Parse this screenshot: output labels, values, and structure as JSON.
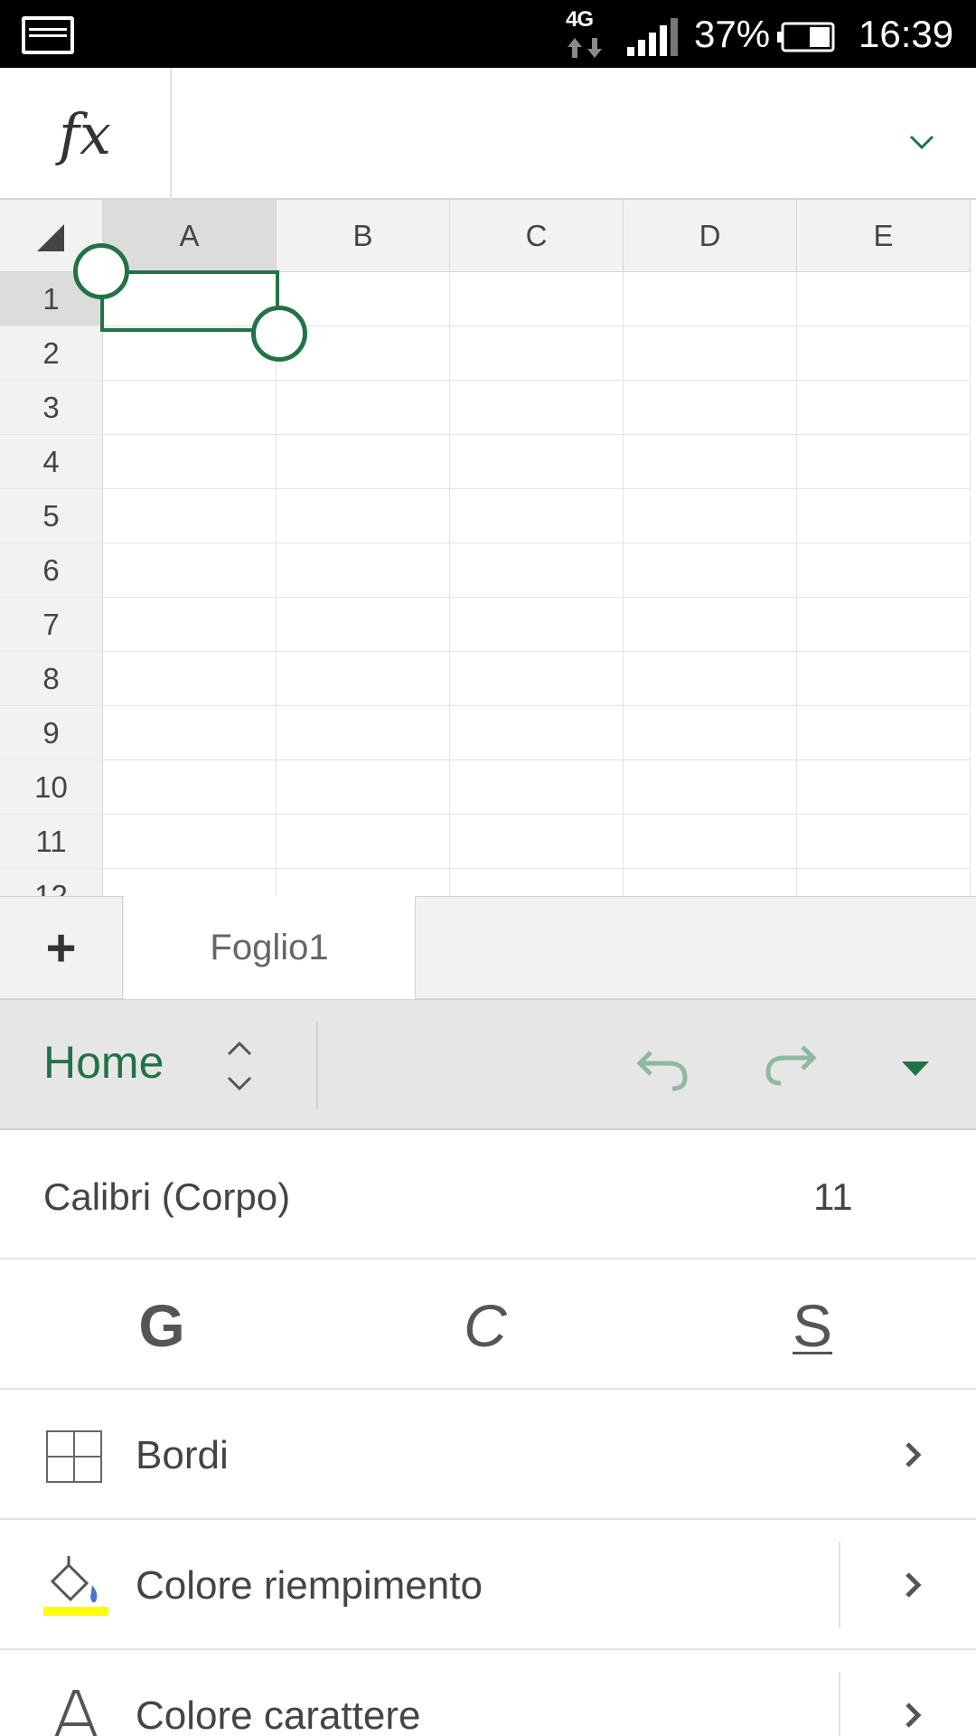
{
  "status_bar": {
    "network": "4G",
    "battery_percent": "37%",
    "time": "16:39"
  },
  "formula_bar": {
    "fx_label": "fx",
    "value": ""
  },
  "grid": {
    "columns": [
      "A",
      "B",
      "C",
      "D",
      "E"
    ],
    "rows": [
      "1",
      "2",
      "3",
      "4",
      "5",
      "6",
      "7",
      "8",
      "9",
      "10",
      "11",
      "12"
    ],
    "selected_cell": "A1"
  },
  "sheets": {
    "add_label": "+",
    "tabs": [
      "Foglio1"
    ]
  },
  "ribbon": {
    "tab": "Home",
    "font_name": "Calibri (Corpo)",
    "font_size": "11",
    "bold": "G",
    "italic": "C",
    "underline": "S",
    "items": [
      {
        "label": "Bordi",
        "icon": "borders-icon"
      },
      {
        "label": "Colore riempimento",
        "icon": "paint-bucket-icon"
      },
      {
        "label": "Colore carattere",
        "icon": "font-color-icon"
      }
    ]
  },
  "colors": {
    "accent": "#217346",
    "fill_highlight": "#ffff00"
  }
}
